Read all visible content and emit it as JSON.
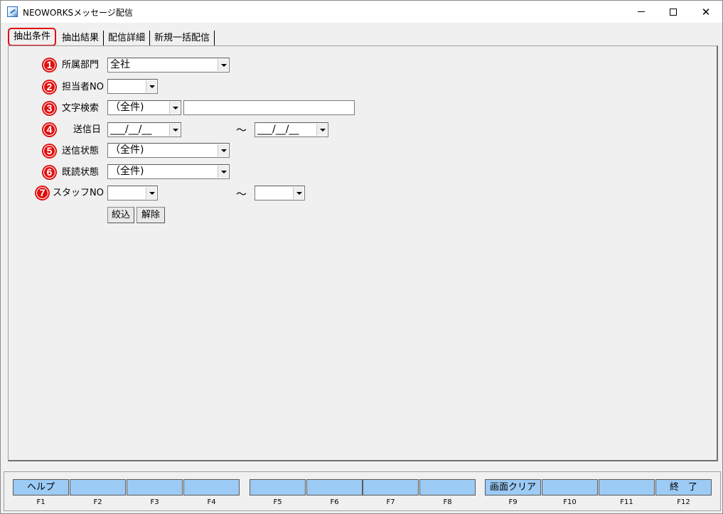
{
  "window": {
    "title": "NEOWORKSメッセージ配信"
  },
  "tabs": [
    {
      "label": "抽出条件"
    },
    {
      "label": "抽出結果"
    },
    {
      "label": "配信詳細"
    },
    {
      "label": "新規一括配信"
    }
  ],
  "form": {
    "rows": [
      {
        "num": "1",
        "label": "所属部門",
        "value": "全社"
      },
      {
        "num": "2",
        "label": "担当者NO",
        "value": ""
      },
      {
        "num": "3",
        "label": "文字検索",
        "value": "（全件)",
        "text": ""
      },
      {
        "num": "4",
        "label": "送信日",
        "from": "___/__/__",
        "to": "___/__/__"
      },
      {
        "num": "5",
        "label": "送信状態",
        "value": "（全件)"
      },
      {
        "num": "6",
        "label": "既読状態",
        "value": "（全件)"
      },
      {
        "num": "7",
        "label": "スタッフNO",
        "from": "",
        "to": ""
      }
    ],
    "range_separator": "～",
    "filter_button": "絞込",
    "clear_button": "解除"
  },
  "function_keys": [
    {
      "label": "ヘルプ",
      "key": "F1"
    },
    {
      "label": "",
      "key": "F2"
    },
    {
      "label": "",
      "key": "F3"
    },
    {
      "label": "",
      "key": "F4"
    },
    {
      "label": "",
      "key": "F5"
    },
    {
      "label": "",
      "key": "F6"
    },
    {
      "label": "",
      "key": "F7"
    },
    {
      "label": "",
      "key": "F8"
    },
    {
      "label": "画面クリア",
      "key": "F9"
    },
    {
      "label": "",
      "key": "F10"
    },
    {
      "label": "",
      "key": "F11"
    },
    {
      "label": "終　了",
      "key": "F12"
    }
  ],
  "colors": {
    "accent_red": "#e01010",
    "fkey_blue": "#9ccbf5",
    "background": "#f0f0f0"
  }
}
